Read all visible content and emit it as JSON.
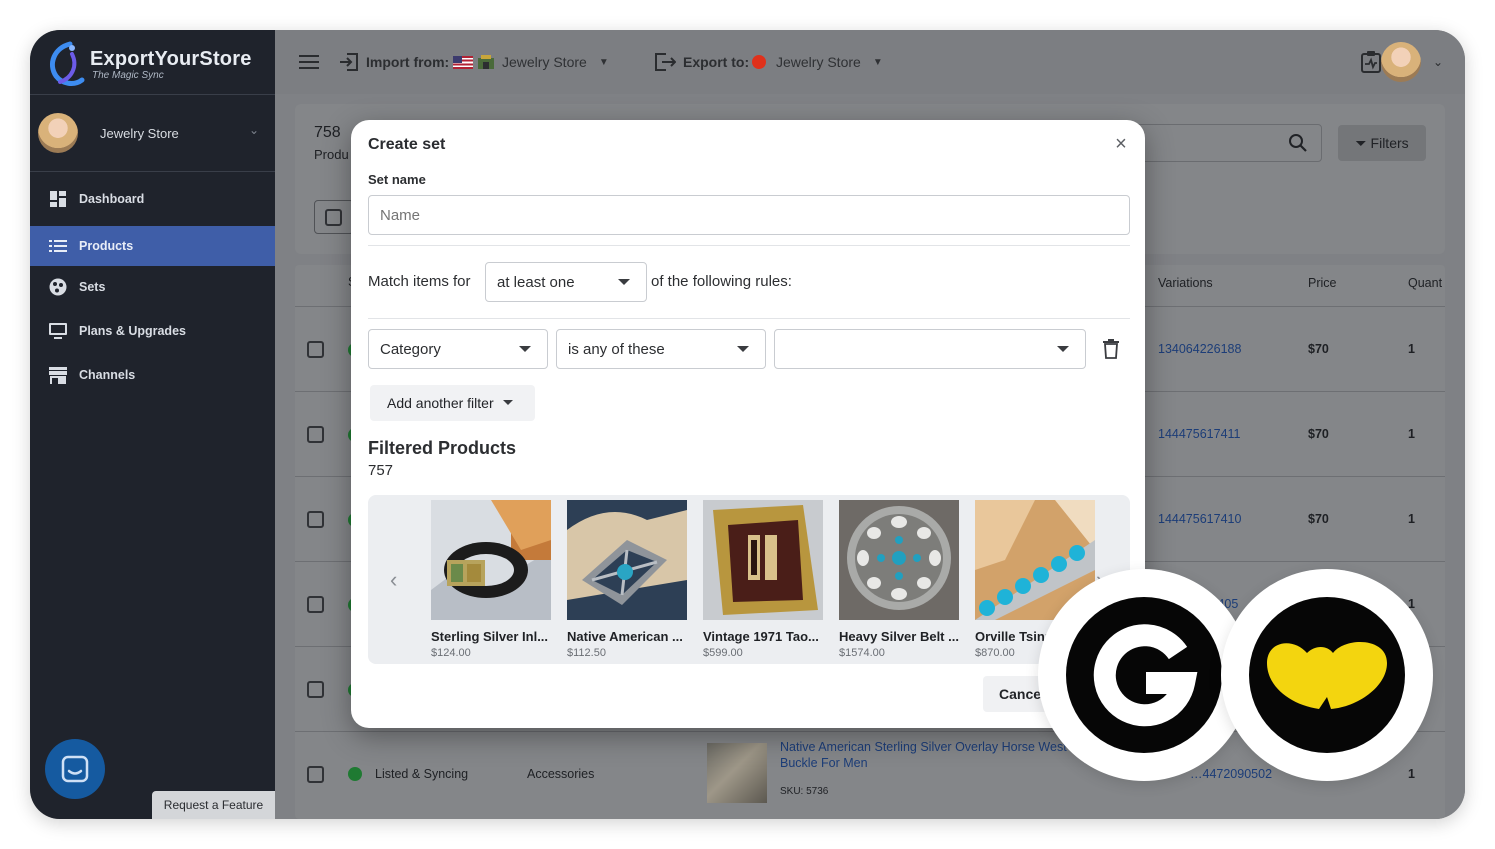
{
  "brand": {
    "name": "ExportYourStore",
    "tagline": "The Magic Sync"
  },
  "sidebar": {
    "store_name": "Jewelry Store",
    "nav": [
      {
        "label": "Dashboard",
        "icon": "dashboard-icon"
      },
      {
        "label": "Products",
        "icon": "list-icon",
        "active": true
      },
      {
        "label": "Sets",
        "icon": "sets-icon"
      },
      {
        "label": "Plans & Upgrades",
        "icon": "monitor-icon"
      },
      {
        "label": "Channels",
        "icon": "store-icon"
      }
    ],
    "request_feature": "Request a Feature"
  },
  "topbar": {
    "import_label": "Import from:",
    "import_store": "Jewelry Store",
    "export_label": "Export to:",
    "export_store": "Jewelry Store"
  },
  "background": {
    "count": "758",
    "count_label": "Produ",
    "filters_label": "Filters",
    "columns": {
      "s": "S",
      "variations": "Variations",
      "price": "Price",
      "quantity": "Quant"
    },
    "rows": [
      {
        "variation": "134064226188",
        "price": "$70",
        "qty": "1"
      },
      {
        "variation": "144475617411",
        "price": "$70",
        "qty": "1"
      },
      {
        "variation": "144475617410",
        "price": "$70",
        "qty": "1"
      },
      {
        "variation": "…7405",
        "price": "",
        "qty": "1"
      },
      {
        "variation": "",
        "price": "",
        "qty": ""
      }
    ],
    "last_row": {
      "status": "Listed & Syncing",
      "category": "Accessories",
      "title_line1": "Native American Sterling Silver Overlay Horse West",
      "title_line2": "Buckle For Men",
      "sku": "SKU: 5736",
      "variation": "…4472090502",
      "qty": "1"
    }
  },
  "modal": {
    "title": "Create set",
    "set_name_label": "Set name",
    "set_name_placeholder": "Name",
    "match_prefix": "Match items for",
    "match_value": "at least one",
    "match_suffix": "of the following rules:",
    "filter_field": "Category",
    "filter_operator": "is any of these",
    "filter_value": "",
    "add_filter": "Add another filter",
    "filtered_title": "Filtered Products",
    "filtered_count": "757",
    "products": [
      {
        "name": "Sterling Silver Inl...",
        "price": "$124.00"
      },
      {
        "name": "Native American ...",
        "price": "$112.50"
      },
      {
        "name": "Vintage 1971 Tao...",
        "price": "$599.00"
      },
      {
        "name": "Heavy Silver Belt ...",
        "price": "$1574.00"
      },
      {
        "name": "Orville Tsinn",
        "price": "$870.00"
      }
    ],
    "cancel_label": "Cance"
  },
  "colors": {
    "sidebar_bg": "#1f232c",
    "active_nav": "#3f5ea8",
    "link": "#1c6cd8",
    "accent_yellow": "#f3d50f"
  }
}
